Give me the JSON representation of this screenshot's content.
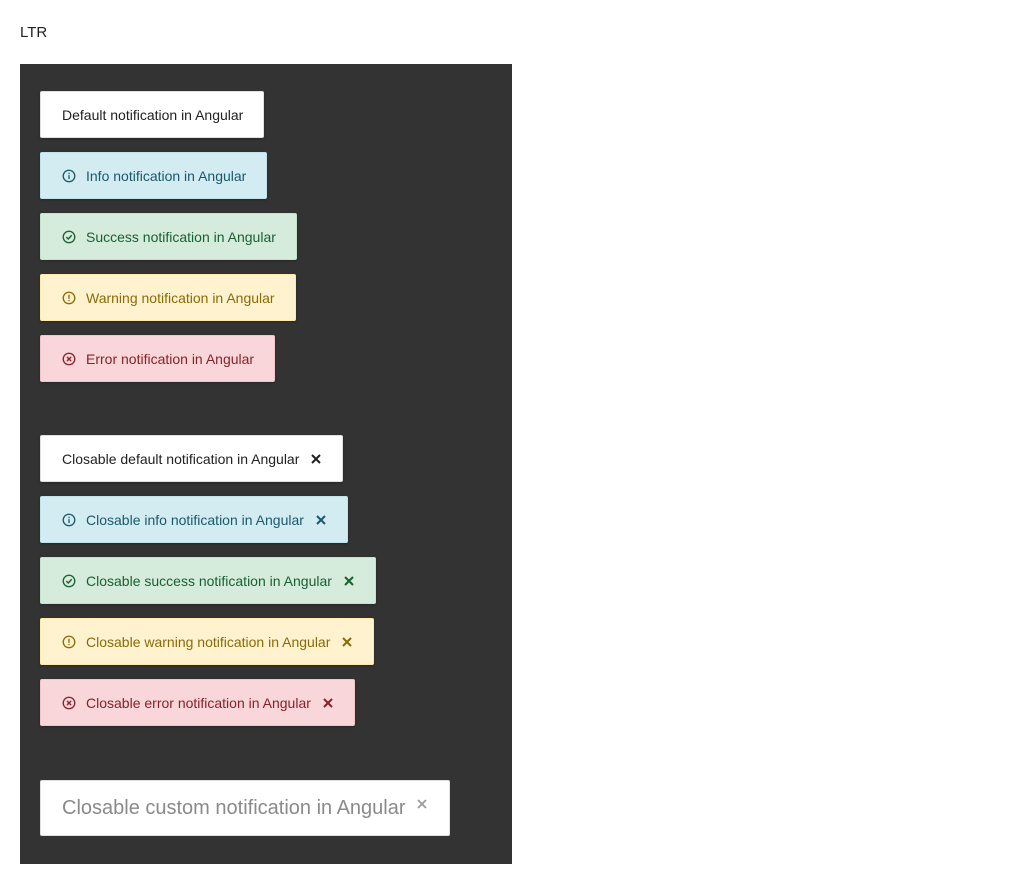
{
  "direction_label": "LTR",
  "notifications": [
    {
      "kind": "default",
      "text": "Default notification in Angular",
      "icon": null,
      "closable": false
    },
    {
      "kind": "info",
      "text": "Info notification in Angular",
      "icon": "info-circle-icon",
      "closable": false
    },
    {
      "kind": "success",
      "text": "Success notification in Angular",
      "icon": "check-circle-icon",
      "closable": false
    },
    {
      "kind": "warning",
      "text": "Warning notification in Angular",
      "icon": "exclamation-circle-icon",
      "closable": false
    },
    {
      "kind": "error",
      "text": "Error notification in Angular",
      "icon": "x-circle-icon",
      "closable": false
    }
  ],
  "closable_notifications": [
    {
      "kind": "default",
      "text": "Closable default notification in Angular",
      "icon": null,
      "closable": true
    },
    {
      "kind": "info",
      "text": "Closable info notification in Angular",
      "icon": "info-circle-icon",
      "closable": true
    },
    {
      "kind": "success",
      "text": "Closable success notification in Angular",
      "icon": "check-circle-icon",
      "closable": true
    },
    {
      "kind": "warning",
      "text": "Closable warning notification in Angular",
      "icon": "exclamation-circle-icon",
      "closable": true
    },
    {
      "kind": "error",
      "text": "Closable error notification in Angular",
      "icon": "x-circle-icon",
      "closable": true
    }
  ],
  "custom_notification": {
    "text": "Closable custom notification in Angular",
    "closable": true
  },
  "colors": {
    "panel_background": "#333333",
    "info": "#d3ecf2",
    "success": "#d5ecdc",
    "warning": "#fff3cf",
    "error": "#f8d6d9"
  }
}
